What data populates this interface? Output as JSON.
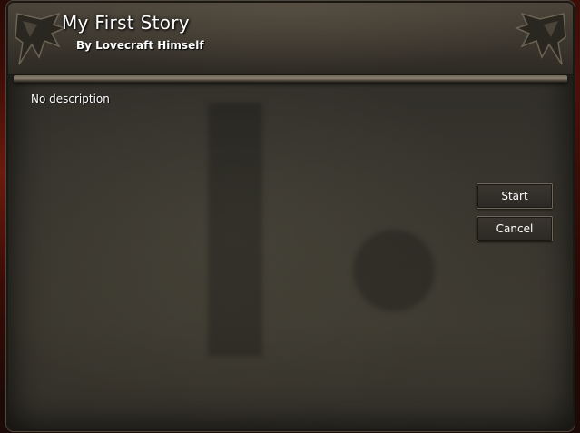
{
  "story": {
    "title": "My First Story",
    "author_line": "By Lovecraft Himself",
    "description": "No description"
  },
  "actions": {
    "start_label": "Start",
    "cancel_label": "Cancel"
  },
  "icons": {
    "left_ornament": "bat-wing-ornament-icon",
    "right_ornament": "bat-wing-ornament-icon"
  },
  "colors": {
    "text": "#ffffff",
    "panel": "#35332c",
    "button_border": "#6e6656"
  }
}
